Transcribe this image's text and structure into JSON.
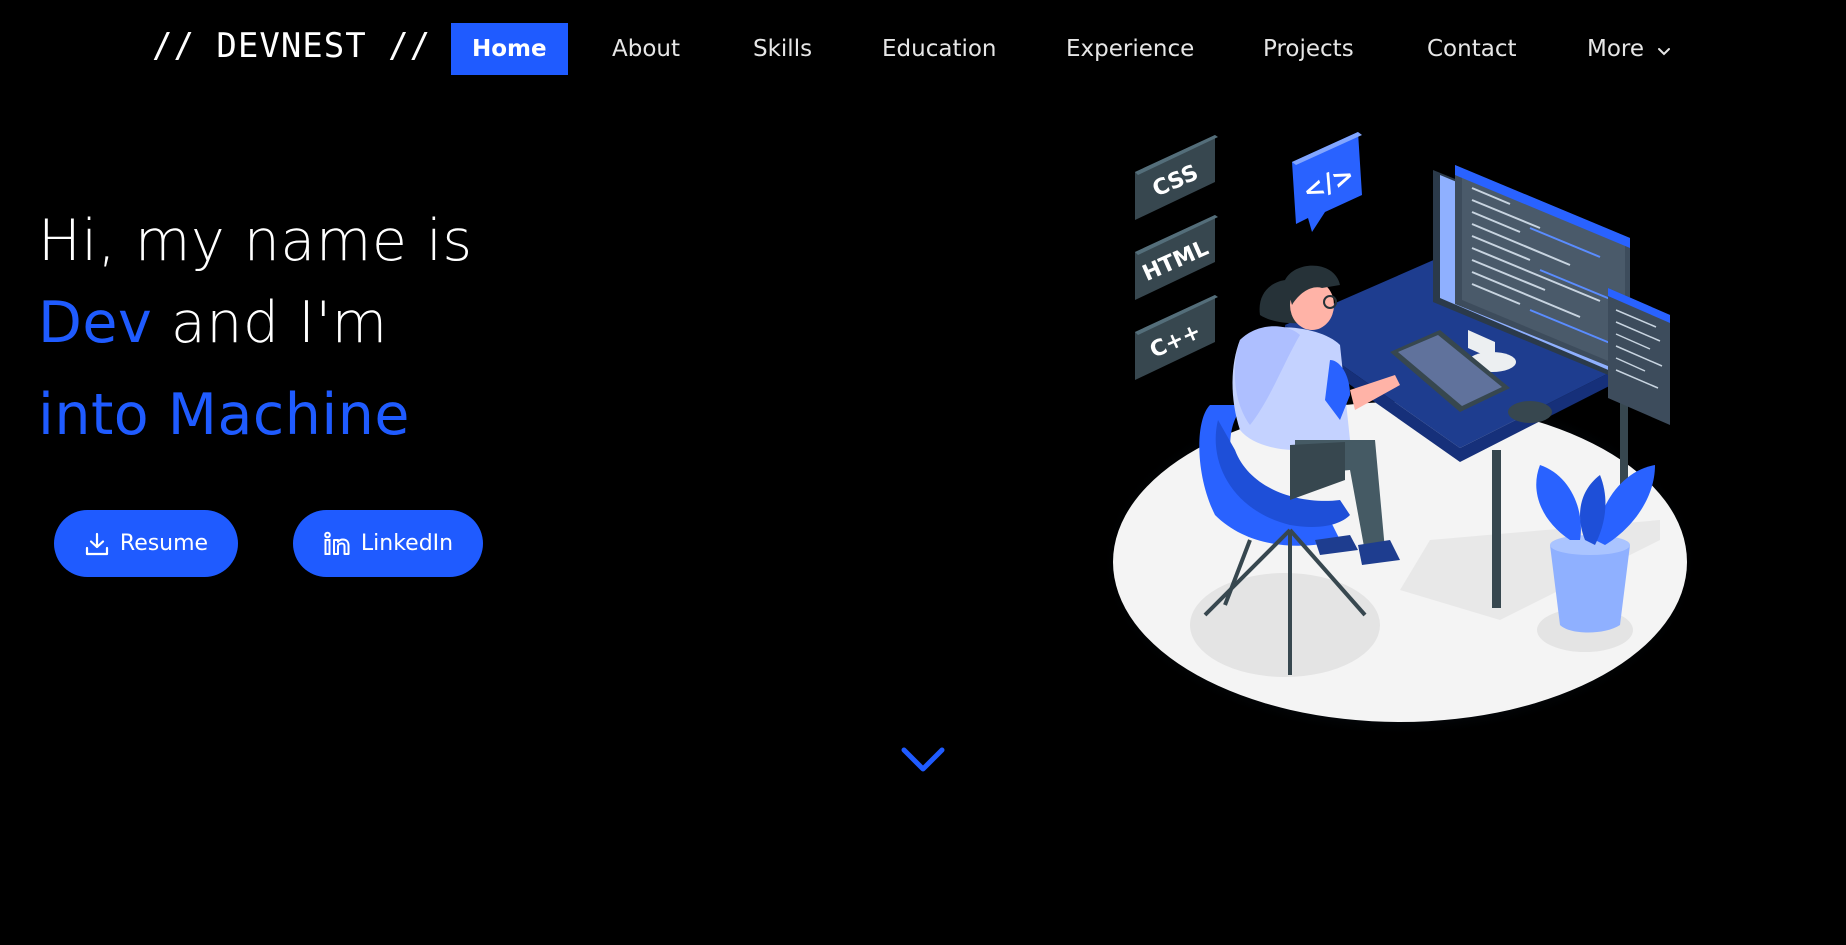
{
  "nav": {
    "logo": "// DEVNEST //",
    "items": [
      {
        "label": "Home",
        "active": true
      },
      {
        "label": "About"
      },
      {
        "label": "Skills"
      },
      {
        "label": "Education"
      },
      {
        "label": "Experience"
      },
      {
        "label": "Projects"
      },
      {
        "label": "Contact"
      },
      {
        "label": "More"
      }
    ]
  },
  "hero": {
    "line1": "Hi, my name is",
    "name": "Dev",
    "line2_rest": " and I'm",
    "line3": "into Machine"
  },
  "buttons": {
    "resume": "Resume",
    "linkedin": "LinkedIn"
  },
  "illustration": {
    "tags": [
      "CSS",
      "HTML",
      "C++"
    ],
    "code_bubble": "</>"
  },
  "colors": {
    "accent": "#1f5bff",
    "background": "#000000",
    "text": "#ffffff"
  },
  "icons": {
    "resume": "download-icon",
    "linkedin": "linkedin-icon",
    "more": "chevron-down-icon",
    "scroll": "chevron-down-icon"
  }
}
